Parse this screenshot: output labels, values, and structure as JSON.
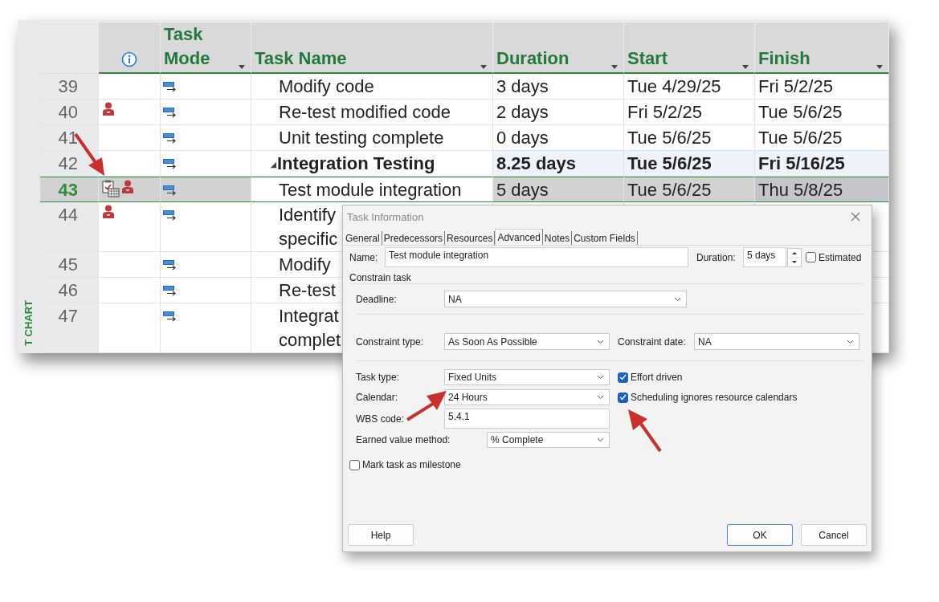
{
  "side_label": "T CHART",
  "columns": [
    {
      "kind": "info"
    },
    {
      "kind": "text",
      "label": "Task Mode"
    },
    {
      "kind": "text",
      "label": "Task Name"
    },
    {
      "kind": "text",
      "label": "Duration"
    },
    {
      "kind": "text",
      "label": "Start"
    },
    {
      "kind": "text",
      "label": "Finish"
    }
  ],
  "rows": [
    {
      "id": "39",
      "calendar_indicator": false,
      "resource_indicator": false,
      "name": "Modify code",
      "duration": "3 days",
      "start": "Tue 4/29/25",
      "finish": "Fri 5/2/25",
      "summary": false,
      "selected": false
    },
    {
      "id": "40",
      "calendar_indicator": false,
      "resource_indicator": true,
      "name": "Re-test modified code",
      "duration": "2 days",
      "start": "Fri 5/2/25",
      "finish": "Tue 5/6/25",
      "summary": false,
      "selected": false
    },
    {
      "id": "41",
      "calendar_indicator": false,
      "resource_indicator": false,
      "name": "Unit testing complete",
      "duration": "0 days",
      "start": "Tue 5/6/25",
      "finish": "Tue 5/6/25",
      "summary": false,
      "selected": false
    },
    {
      "id": "42",
      "calendar_indicator": false,
      "resource_indicator": false,
      "toggle": "◢",
      "name": "Integration Testing",
      "duration": "8.25 days",
      "start": "Tue 5/6/25",
      "finish": "Fri 5/16/25",
      "summary": true,
      "selected": false
    },
    {
      "id": "43",
      "calendar_indicator": true,
      "resource_indicator": true,
      "name": "Test module integration",
      "duration": "5 days",
      "start": "Tue 5/6/25",
      "finish": "Thu 5/8/25",
      "summary": false,
      "selected": true
    },
    {
      "id": "44",
      "calendar_indicator": false,
      "resource_indicator": true,
      "name": "Identify\nspecific",
      "summary": false,
      "selected": false
    },
    {
      "id": "45",
      "calendar_indicator": false,
      "resource_indicator": false,
      "name": "Modify",
      "summary": false,
      "selected": false
    },
    {
      "id": "46",
      "calendar_indicator": false,
      "resource_indicator": false,
      "name": "Re-test",
      "summary": false,
      "selected": false
    },
    {
      "id": "47",
      "calendar_indicator": false,
      "resource_indicator": false,
      "name": "Integrat\ncomplet",
      "summary": false,
      "selected": false
    }
  ],
  "dialog": {
    "title": "Task Information",
    "tabs": [
      {
        "label": "General",
        "selected": false
      },
      {
        "label": "Predecessors",
        "selected": false
      },
      {
        "label": "Resources",
        "selected": false
      },
      {
        "label": "Advanced",
        "selected": true
      },
      {
        "label": "Notes",
        "selected": false
      },
      {
        "label": "Custom Fields",
        "selected": false
      }
    ],
    "name": {
      "label": "Name:",
      "value": "Test module integration"
    },
    "duration": {
      "label": "Duration:",
      "value": "5 days"
    },
    "estimated": {
      "label": "Estimated",
      "checked": false
    },
    "group_label": "Constrain task",
    "deadline": {
      "label": "Deadline:",
      "value": "NA"
    },
    "constraint_type": {
      "label": "Constraint type:",
      "value": "As Soon As Possible"
    },
    "constraint_date": {
      "label": "Constraint date:",
      "value": "NA"
    },
    "task_type": {
      "label": "Task type:",
      "value": "Fixed Units"
    },
    "effort_driven": {
      "label": "Effort driven",
      "checked": true
    },
    "calendar": {
      "label": "Calendar:",
      "value": "24 Hours"
    },
    "ignore_calendars": {
      "label": "Scheduling ignores resource calendars",
      "checked": true
    },
    "wbs": {
      "label": "WBS code:",
      "value": "5.4.1"
    },
    "earned_value": {
      "label": "Earned value method:",
      "value": "% Complete"
    },
    "milestone": {
      "label": "Mark task as milestone",
      "checked": false
    },
    "buttons": [
      {
        "label": "Help",
        "kind": "help"
      },
      {
        "label": "OK",
        "kind": "default"
      },
      {
        "label": "Cancel",
        "kind": "cancel"
      }
    ]
  }
}
